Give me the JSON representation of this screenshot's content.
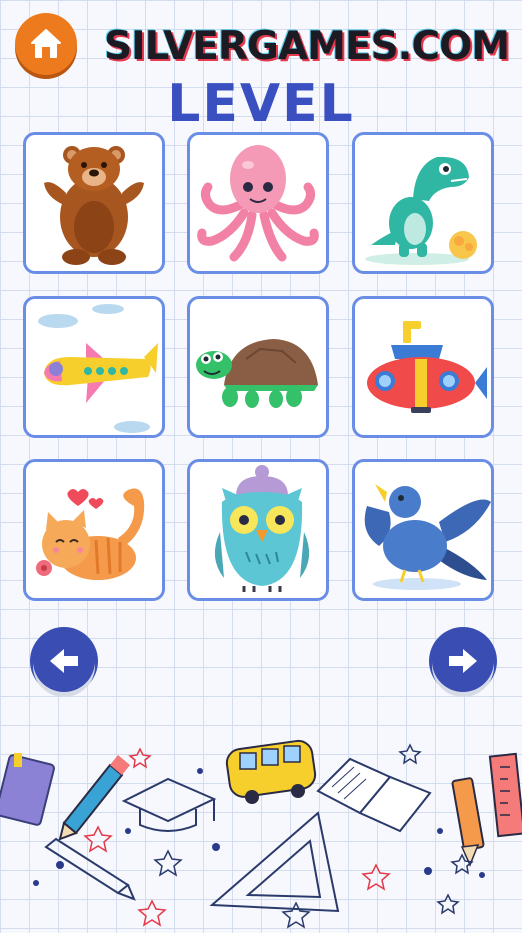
{
  "header": {
    "home_icon": "home-icon",
    "brand": "SILVERGAMES.COM",
    "title": "LEVEL"
  },
  "levels": [
    {
      "icon": "bear-icon",
      "name": "bear"
    },
    {
      "icon": "octopus-icon",
      "name": "octopus"
    },
    {
      "icon": "dinosaur-icon",
      "name": "dinosaur"
    },
    {
      "icon": "airplane-icon",
      "name": "airplane"
    },
    {
      "icon": "turtle-icon",
      "name": "turtle"
    },
    {
      "icon": "submarine-icon",
      "name": "submarine"
    },
    {
      "icon": "cat-icon",
      "name": "cat"
    },
    {
      "icon": "owl-icon",
      "name": "owl"
    },
    {
      "icon": "bird-icon",
      "name": "bird"
    }
  ],
  "navigation": {
    "prev_icon": "arrow-left-icon",
    "next_icon": "arrow-right-icon"
  },
  "colors": {
    "accent": "#3a4fc0",
    "tile_border": "#6a8ee6",
    "home_button": "#ee7a1e"
  }
}
